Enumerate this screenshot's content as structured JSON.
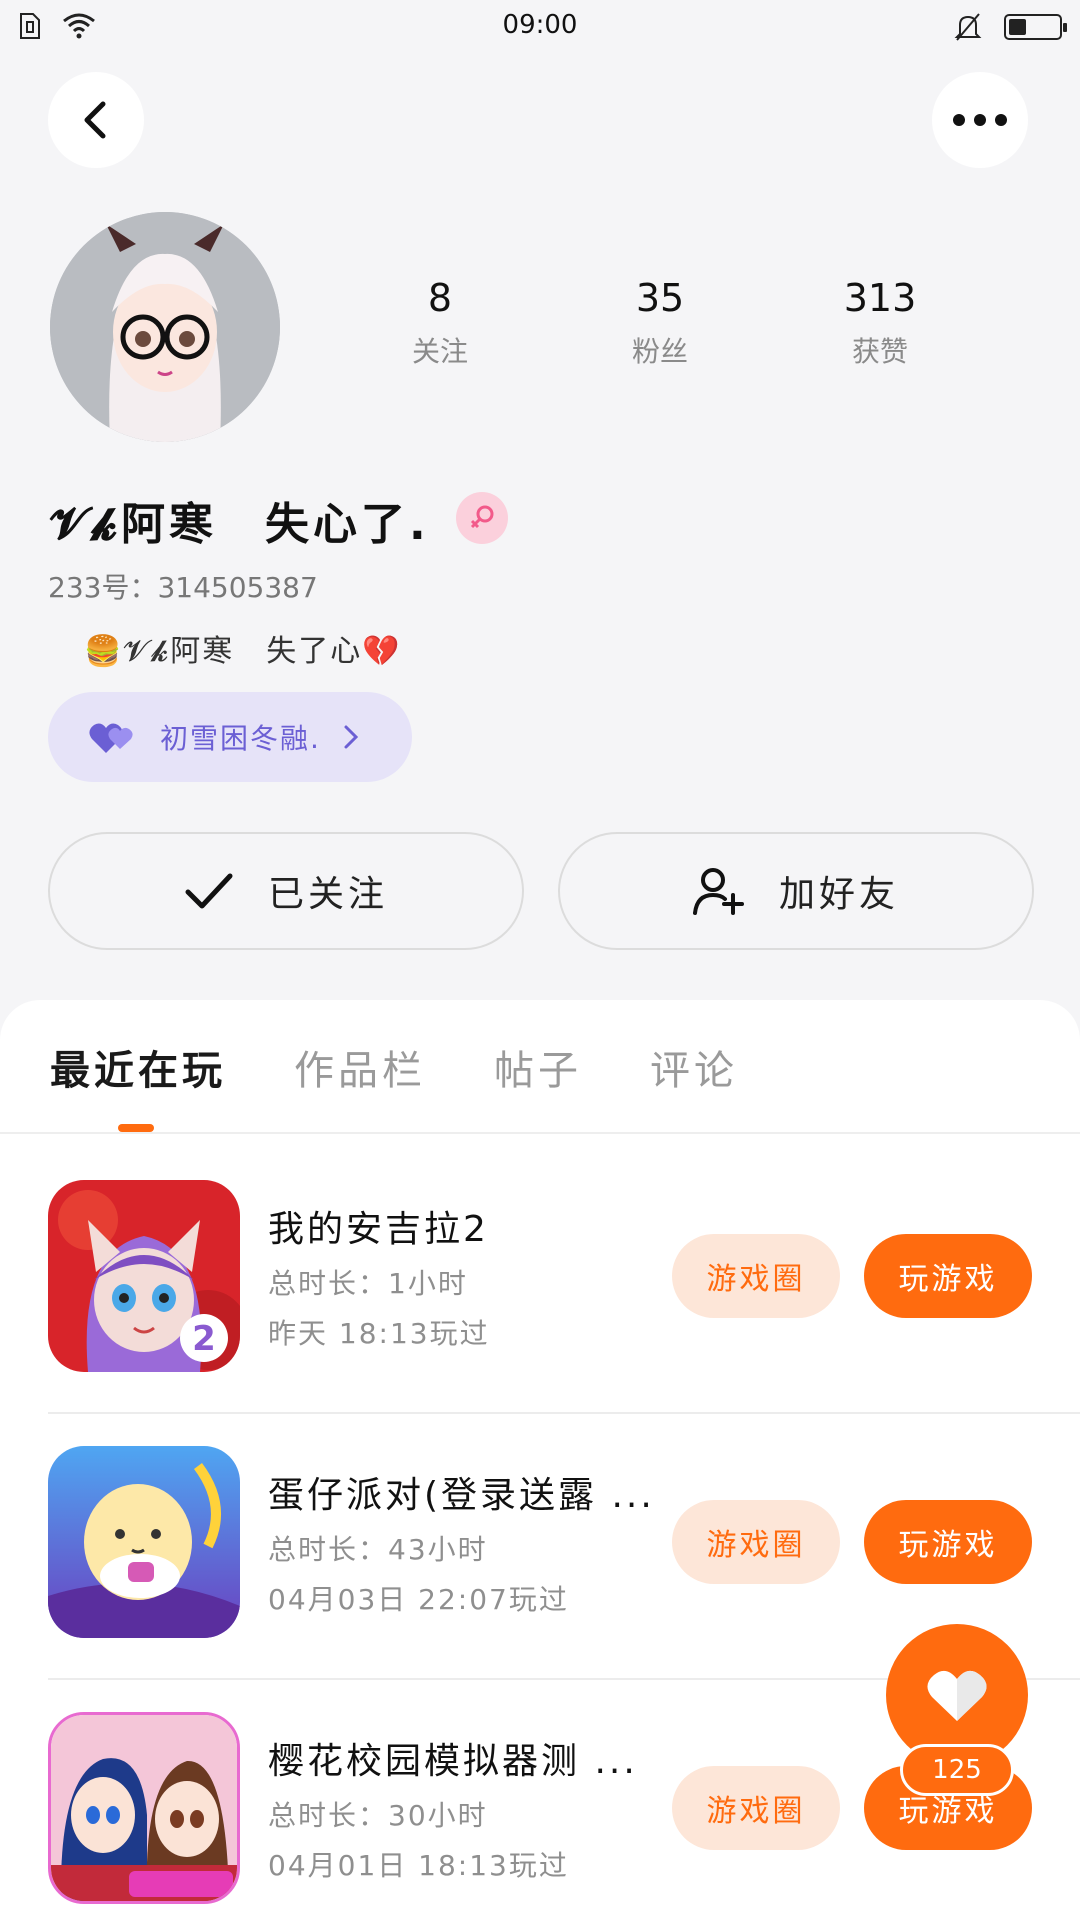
{
  "status_bar": {
    "time": "09:00",
    "battery_level": 0.35,
    "icons": [
      "sim-icon",
      "wifi-icon",
      "mute-bell-icon",
      "battery-icon"
    ]
  },
  "nav": {
    "back_icon": "chevron-left-icon",
    "more_icon": "more-dots-icon"
  },
  "profile": {
    "stats": [
      {
        "num": "8",
        "label": "关注"
      },
      {
        "num": "35",
        "label": "粉丝"
      },
      {
        "num": "313",
        "label": "获赞"
      }
    ],
    "username": "𝓥𝓴阿寒　失心了.",
    "gender_icon": "female-icon",
    "uid": "233号：314505387",
    "bio": "🍔𝓥𝓴阿寒　失了心💔",
    "tag": "初雪困冬融."
  },
  "actions": {
    "followed": "已关注",
    "add_friend": "加好友"
  },
  "tabs": [
    "最近在玩",
    "作品栏",
    "帖子",
    "评论"
  ],
  "games": [
    {
      "title": "我的安吉拉2",
      "duration": "总时长：1小时",
      "last_played": "昨天 18:13玩过",
      "circle": "游戏圈",
      "play": "玩游戏"
    },
    {
      "title": "蛋仔派对(登录送露 ...",
      "duration": "总时长：43小时",
      "last_played": "04月03日 22:07玩过",
      "circle": "游戏圈",
      "play": "玩游戏"
    },
    {
      "title": "樱花校园模拟器测 ...",
      "duration": "总时长：30小时",
      "last_played": "04月01日 18:13玩过",
      "circle": "游戏圈",
      "play": "玩游戏"
    }
  ],
  "like_fab": {
    "count": "125"
  },
  "colors": {
    "accent": "#ff6b0f",
    "accent_light": "#fde6d8",
    "tag_bg": "#e6e3f8",
    "tag_text": "#6b5fd4"
  }
}
